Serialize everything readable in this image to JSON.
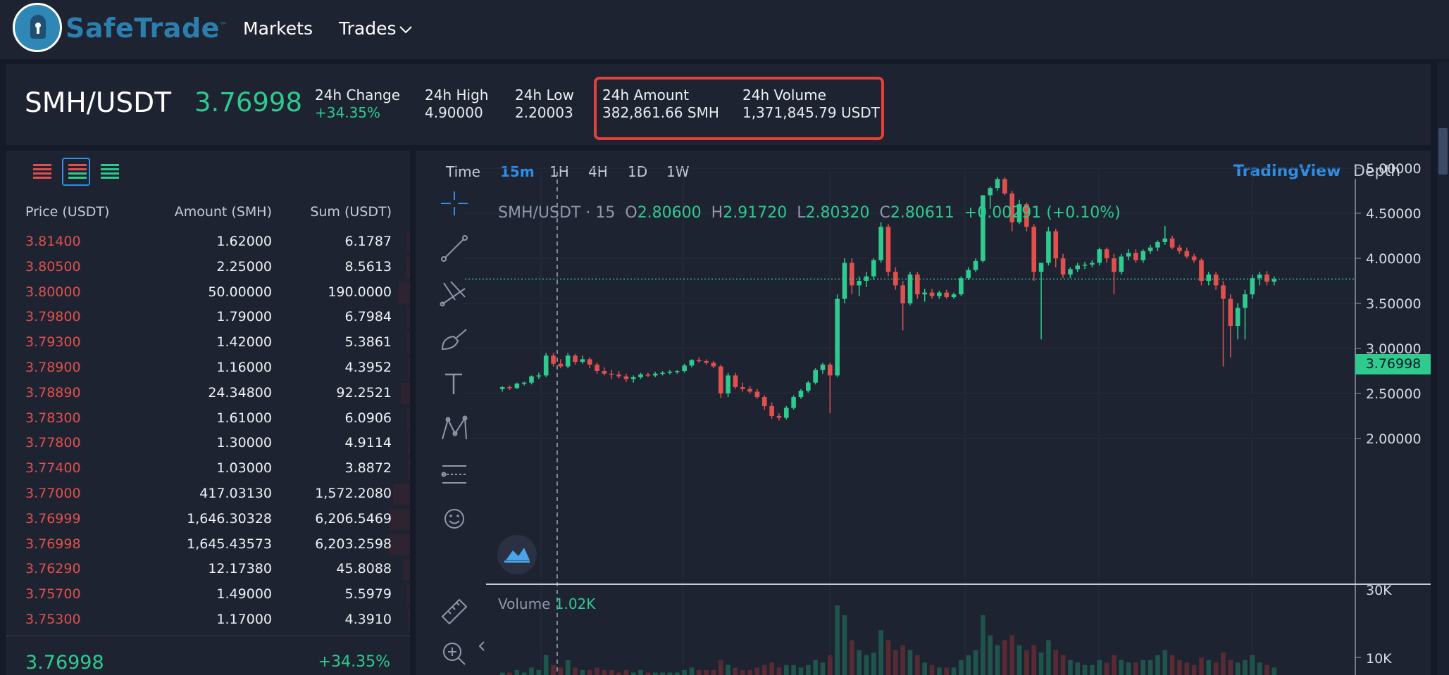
{
  "header": {
    "logo_text": "SafeTrade",
    "logo_tm": "™",
    "nav": {
      "markets": "Markets",
      "trades": "Trades"
    }
  },
  "ticker": {
    "pair": "SMH/USDT",
    "last_price": "3.76998",
    "stats": {
      "change": {
        "label": "24h Change",
        "value": "+34.35%"
      },
      "high": {
        "label": "24h High",
        "value": "4.90000"
      },
      "low": {
        "label": "24h Low",
        "value": "2.20003"
      },
      "amount": {
        "label": "24h Amount",
        "value": "382,861.66 SMH"
      },
      "volume": {
        "label": "24h Volume",
        "value": "1,371,845.79 USDT"
      }
    },
    "highlight_color": "#e4403a"
  },
  "orderbook": {
    "headers": {
      "price": "Price (USDT)",
      "amount": "Amount (SMH)",
      "sum": "Sum (USDT)"
    },
    "view_modes": [
      "sell-orders",
      "all-orders",
      "buy-orders"
    ],
    "active_view": "all-orders",
    "rows": [
      {
        "price": "3.81400",
        "amount": "1.62000",
        "sum": "6.1787"
      },
      {
        "price": "3.80500",
        "amount": "2.25000",
        "sum": "8.5613"
      },
      {
        "price": "3.80000",
        "amount": "50.00000",
        "sum": "190.0000"
      },
      {
        "price": "3.79800",
        "amount": "1.79000",
        "sum": "6.7984"
      },
      {
        "price": "3.79300",
        "amount": "1.42000",
        "sum": "5.3861"
      },
      {
        "price": "3.78900",
        "amount": "1.16000",
        "sum": "4.3952"
      },
      {
        "price": "3.78890",
        "amount": "24.34800",
        "sum": "92.2521"
      },
      {
        "price": "3.78300",
        "amount": "1.61000",
        "sum": "6.0906"
      },
      {
        "price": "3.77800",
        "amount": "1.30000",
        "sum": "4.9114"
      },
      {
        "price": "3.77400",
        "amount": "1.03000",
        "sum": "3.8872"
      },
      {
        "price": "3.77000",
        "amount": "417.03130",
        "sum": "1,572.2080"
      },
      {
        "price": "3.76999",
        "amount": "1,646.30328",
        "sum": "6,206.5469"
      },
      {
        "price": "3.76998",
        "amount": "1,645.43573",
        "sum": "6,203.2598"
      },
      {
        "price": "3.76290",
        "amount": "12.17380",
        "sum": "45.8088"
      },
      {
        "price": "3.75700",
        "amount": "1.49000",
        "sum": "5.5979"
      },
      {
        "price": "3.75300",
        "amount": "1.17000",
        "sum": "4.3910"
      }
    ],
    "last_price": "3.76998",
    "last_change": "+34.35%"
  },
  "chart": {
    "timeframes": [
      "Time",
      "15m",
      "1H",
      "4H",
      "1D",
      "1W"
    ],
    "active_timeframe": "15m",
    "tabs": {
      "tradingview": "TradingView",
      "depth": "Depth"
    },
    "legend": {
      "symbol": "SMH/USDT",
      "interval": "15",
      "open_label": "O",
      "open": "2.80600",
      "high_label": "H",
      "high": "2.91720",
      "low_label": "L",
      "low": "2.80320",
      "close_label": "C",
      "close": "2.80611",
      "change": "+0.00291 (+0.10%)"
    },
    "volume_legend": {
      "label": "Volume",
      "value": "1.02K"
    },
    "price_axis_labels": [
      "5.00000",
      "4.50000",
      "4.00000",
      "3.50000",
      "3.00000",
      "2.50000",
      "2.00000"
    ],
    "volume_axis_labels": [
      "30K",
      "10K"
    ],
    "current_price_tag": "3.76998",
    "tools": [
      "crosshair-icon",
      "trend-line-icon",
      "pitchfork-icon",
      "brush-icon",
      "text-tool-icon",
      "pattern-icon",
      "prediction-icon",
      "emoji-icon",
      "ruler-icon",
      "zoom-in-icon"
    ],
    "colors": {
      "up": "#2eca8e",
      "down": "#e0504d",
      "accent": "#2e8de4"
    }
  },
  "chart_data": {
    "type": "candlestick",
    "title": "SMH/USDT",
    "interval": "15",
    "ylim": [
      1.95,
      5.15
    ],
    "current_price": 3.76998,
    "candles": [
      [
        2.55,
        2.58,
        2.52,
        2.57
      ],
      [
        2.57,
        2.59,
        2.54,
        2.56
      ],
      [
        2.56,
        2.62,
        2.55,
        2.61
      ],
      [
        2.61,
        2.63,
        2.59,
        2.62
      ],
      [
        2.62,
        2.7,
        2.6,
        2.69
      ],
      [
        2.69,
        2.73,
        2.66,
        2.7
      ],
      [
        2.7,
        2.95,
        2.68,
        2.92
      ],
      [
        2.92,
        2.95,
        2.8,
        2.83
      ],
      [
        2.83,
        2.88,
        2.78,
        2.8
      ],
      [
        2.8,
        2.95,
        2.78,
        2.92
      ],
      [
        2.92,
        2.94,
        2.82,
        2.85
      ],
      [
        2.85,
        2.92,
        2.83,
        2.88
      ],
      [
        2.88,
        2.9,
        2.78,
        2.82
      ],
      [
        2.82,
        2.84,
        2.72,
        2.75
      ],
      [
        2.75,
        2.79,
        2.7,
        2.72
      ],
      [
        2.72,
        2.76,
        2.66,
        2.71
      ],
      [
        2.71,
        2.75,
        2.67,
        2.69
      ],
      [
        2.69,
        2.72,
        2.63,
        2.66
      ],
      [
        2.66,
        2.7,
        2.62,
        2.68
      ],
      [
        2.68,
        2.73,
        2.66,
        2.71
      ],
      [
        2.71,
        2.73,
        2.68,
        2.7
      ],
      [
        2.7,
        2.74,
        2.68,
        2.72
      ],
      [
        2.72,
        2.75,
        2.7,
        2.73
      ],
      [
        2.73,
        2.76,
        2.71,
        2.74
      ],
      [
        2.74,
        2.76,
        2.72,
        2.75
      ],
      [
        2.75,
        2.83,
        2.73,
        2.81
      ],
      [
        2.81,
        2.88,
        2.79,
        2.87
      ],
      [
        2.87,
        2.9,
        2.84,
        2.86
      ],
      [
        2.86,
        2.88,
        2.82,
        2.84
      ],
      [
        2.84,
        2.86,
        2.78,
        2.8
      ],
      [
        2.8,
        2.82,
        2.45,
        2.5
      ],
      [
        2.5,
        2.73,
        2.46,
        2.7
      ],
      [
        2.7,
        2.73,
        2.55,
        2.57
      ],
      [
        2.57,
        2.62,
        2.52,
        2.55
      ],
      [
        2.55,
        2.58,
        2.5,
        2.52
      ],
      [
        2.52,
        2.55,
        2.44,
        2.46
      ],
      [
        2.46,
        2.48,
        2.32,
        2.36
      ],
      [
        2.36,
        2.4,
        2.22,
        2.25
      ],
      [
        2.25,
        2.28,
        2.2,
        2.23
      ],
      [
        2.23,
        2.36,
        2.21,
        2.34
      ],
      [
        2.34,
        2.48,
        2.32,
        2.46
      ],
      [
        2.46,
        2.55,
        2.44,
        2.53
      ],
      [
        2.53,
        2.64,
        2.51,
        2.62
      ],
      [
        2.62,
        2.78,
        2.6,
        2.76
      ],
      [
        2.76,
        2.84,
        2.72,
        2.82
      ],
      [
        2.82,
        2.84,
        2.28,
        2.7
      ],
      [
        2.7,
        3.6,
        2.68,
        3.55
      ],
      [
        3.55,
        4.0,
        3.5,
        3.95
      ],
      [
        3.95,
        4.0,
        3.6,
        3.7
      ],
      [
        3.7,
        3.8,
        3.58,
        3.75
      ],
      [
        3.75,
        3.85,
        3.68,
        3.8
      ],
      [
        3.8,
        4.0,
        3.76,
        3.98
      ],
      [
        3.98,
        4.4,
        3.95,
        4.35
      ],
      [
        4.35,
        4.38,
        3.8,
        3.85
      ],
      [
        3.85,
        3.9,
        3.65,
        3.7
      ],
      [
        3.7,
        3.75,
        3.2,
        3.5
      ],
      [
        3.5,
        3.85,
        3.48,
        3.82
      ],
      [
        3.82,
        3.85,
        3.55,
        3.6
      ],
      [
        3.6,
        3.66,
        3.52,
        3.62
      ],
      [
        3.62,
        3.66,
        3.55,
        3.58
      ],
      [
        3.58,
        3.64,
        3.55,
        3.62
      ],
      [
        3.62,
        3.65,
        3.55,
        3.57
      ],
      [
        3.57,
        3.62,
        3.55,
        3.6
      ],
      [
        3.6,
        3.8,
        3.58,
        3.78
      ],
      [
        3.78,
        3.9,
        3.76,
        3.87
      ],
      [
        3.87,
        4.0,
        3.85,
        3.97
      ],
      [
        3.97,
        4.7,
        3.95,
        4.7
      ],
      [
        4.7,
        4.8,
        4.55,
        4.78
      ],
      [
        4.78,
        4.9,
        4.75,
        4.88
      ],
      [
        4.88,
        4.9,
        4.7,
        4.72
      ],
      [
        4.72,
        4.75,
        4.3,
        4.4
      ],
      [
        4.4,
        4.65,
        4.38,
        4.6
      ],
      [
        4.6,
        4.62,
        4.3,
        4.35
      ],
      [
        4.35,
        4.38,
        3.75,
        3.85
      ],
      [
        3.85,
        3.9,
        3.1,
        3.95
      ],
      [
        3.95,
        4.35,
        3.92,
        4.3
      ],
      [
        4.3,
        4.33,
        3.9,
        4.0
      ],
      [
        4.0,
        4.05,
        3.78,
        3.82
      ],
      [
        3.82,
        3.9,
        3.78,
        3.88
      ],
      [
        3.88,
        3.95,
        3.85,
        3.92
      ],
      [
        3.92,
        3.96,
        3.88,
        3.93
      ],
      [
        3.93,
        3.98,
        3.9,
        3.95
      ],
      [
        3.95,
        4.12,
        3.92,
        4.1
      ],
      [
        4.1,
        4.12,
        3.95,
        4.0
      ],
      [
        4.0,
        4.05,
        3.6,
        3.85
      ],
      [
        3.85,
        4.05,
        3.82,
        4.02
      ],
      [
        4.02,
        4.1,
        3.98,
        4.06
      ],
      [
        4.06,
        4.1,
        3.95,
        3.98
      ],
      [
        3.98,
        4.1,
        3.95,
        4.08
      ],
      [
        4.08,
        4.15,
        4.05,
        4.12
      ],
      [
        4.12,
        4.2,
        4.08,
        4.18
      ],
      [
        4.18,
        4.36,
        4.15,
        4.22
      ],
      [
        4.22,
        4.25,
        4.1,
        4.12
      ],
      [
        4.12,
        4.15,
        4.05,
        4.08
      ],
      [
        4.08,
        4.12,
        4.0,
        4.02
      ],
      [
        4.02,
        4.05,
        3.95,
        3.98
      ],
      [
        3.98,
        4.0,
        3.7,
        3.75
      ],
      [
        3.75,
        3.85,
        3.7,
        3.82
      ],
      [
        3.82,
        3.85,
        3.65,
        3.7
      ],
      [
        3.7,
        3.75,
        2.8,
        3.55
      ],
      [
        3.55,
        3.6,
        2.9,
        3.25
      ],
      [
        3.25,
        3.5,
        3.1,
        3.45
      ],
      [
        3.45,
        3.65,
        3.1,
        3.6
      ],
      [
        3.6,
        3.82,
        3.55,
        3.78
      ],
      [
        3.78,
        3.85,
        3.7,
        3.82
      ],
      [
        3.82,
        3.86,
        3.7,
        3.74
      ],
      [
        3.74,
        3.8,
        3.7,
        3.77
      ]
    ],
    "volume": [
      1,
      1,
      2,
      1,
      3,
      2,
      8,
      4,
      3,
      6,
      3,
      2,
      2,
      3,
      2,
      2,
      1,
      2,
      1,
      2,
      1,
      1,
      1,
      1,
      1,
      2,
      3,
      2,
      2,
      2,
      6,
      4,
      3,
      2,
      2,
      3,
      4,
      5,
      3,
      4,
      4,
      3,
      4,
      6,
      5,
      8,
      28,
      24,
      14,
      10,
      8,
      9,
      18,
      14,
      10,
      12,
      10,
      8,
      5,
      4,
      3,
      3,
      3,
      6,
      8,
      10,
      24,
      16,
      12,
      14,
      16,
      12,
      10,
      12,
      9,
      14,
      10,
      8,
      6,
      5,
      4,
      4,
      6,
      5,
      8,
      6,
      5,
      5,
      6,
      6,
      8,
      10,
      8,
      6,
      5,
      4,
      7,
      6,
      5,
      9,
      6,
      5,
      6,
      8,
      5,
      4,
      3
    ],
    "price_ticks": [
      5.0,
      4.5,
      4.0,
      3.5,
      3.0,
      2.5,
      2.0
    ],
    "volume_ticks": [
      "30K",
      "10K"
    ]
  }
}
